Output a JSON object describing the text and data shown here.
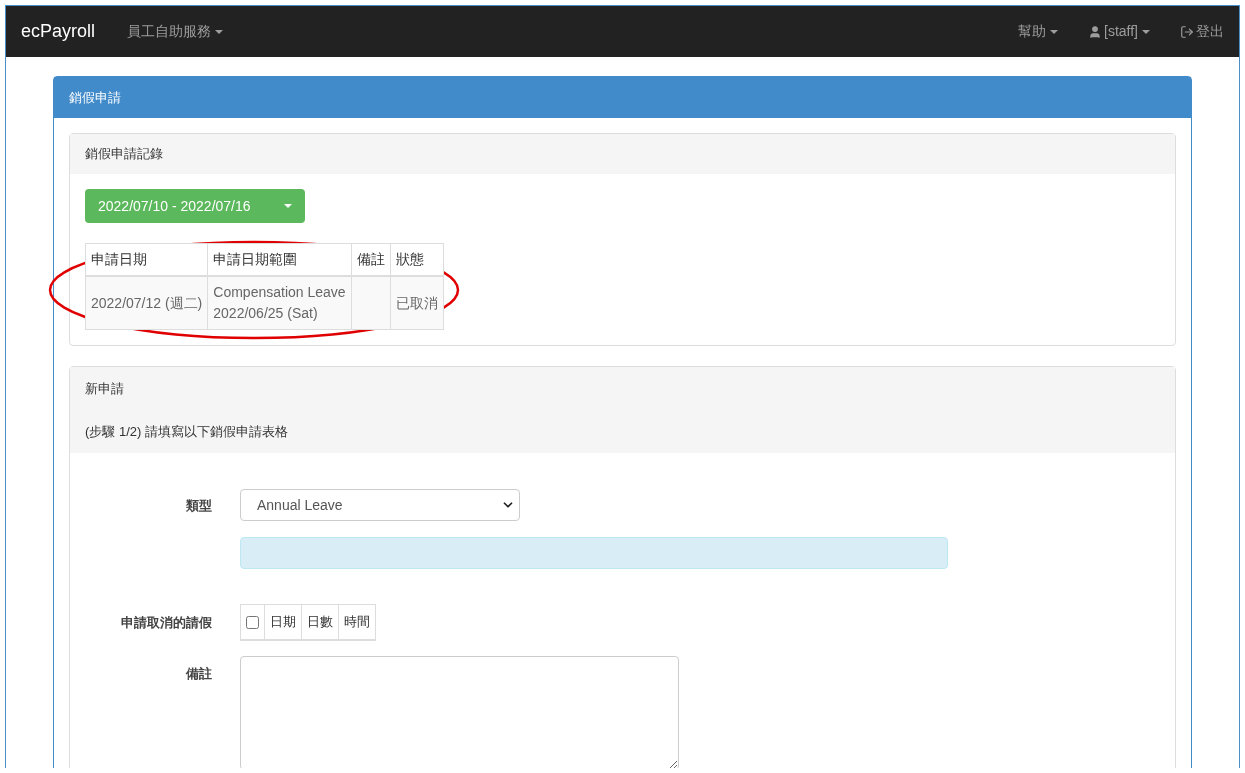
{
  "navbar": {
    "brand": "ecPayroll",
    "menu": [
      {
        "label": "員工自助服務"
      }
    ],
    "right": [
      {
        "kind": "menu",
        "label": "幫助"
      },
      {
        "kind": "user",
        "label": "[staff]"
      },
      {
        "kind": "logout",
        "label": "登出"
      }
    ]
  },
  "panel": {
    "title": "銷假申請",
    "history": {
      "title": "銷假申請記錄",
      "range_button": "2022/07/10 - 2022/07/16",
      "table": {
        "columns": [
          "申請日期",
          "申請日期範圍",
          "備註",
          "狀態"
        ],
        "rows": [
          {
            "cells": [
              [
                "2022/07/12 (週二)"
              ],
              [
                "Compensation Leave",
                "2022/06/25 (Sat)"
              ],
              [],
              [
                "已取消"
              ]
            ]
          }
        ]
      },
      "annotation": {
        "kind": "ellipse",
        "color": "#e00000"
      }
    },
    "new_request": {
      "title": "新申請",
      "step": "(步驟 1/2) 請填寫以下銷假申請表格",
      "type": {
        "label": "類型",
        "value": "Annual Leave"
      },
      "cancel_leave": {
        "label": "申請取消的請假",
        "checked": false,
        "columns": [
          "日期",
          "日數",
          "時間"
        ]
      },
      "remarks": {
        "label": "備註"
      }
    }
  }
}
